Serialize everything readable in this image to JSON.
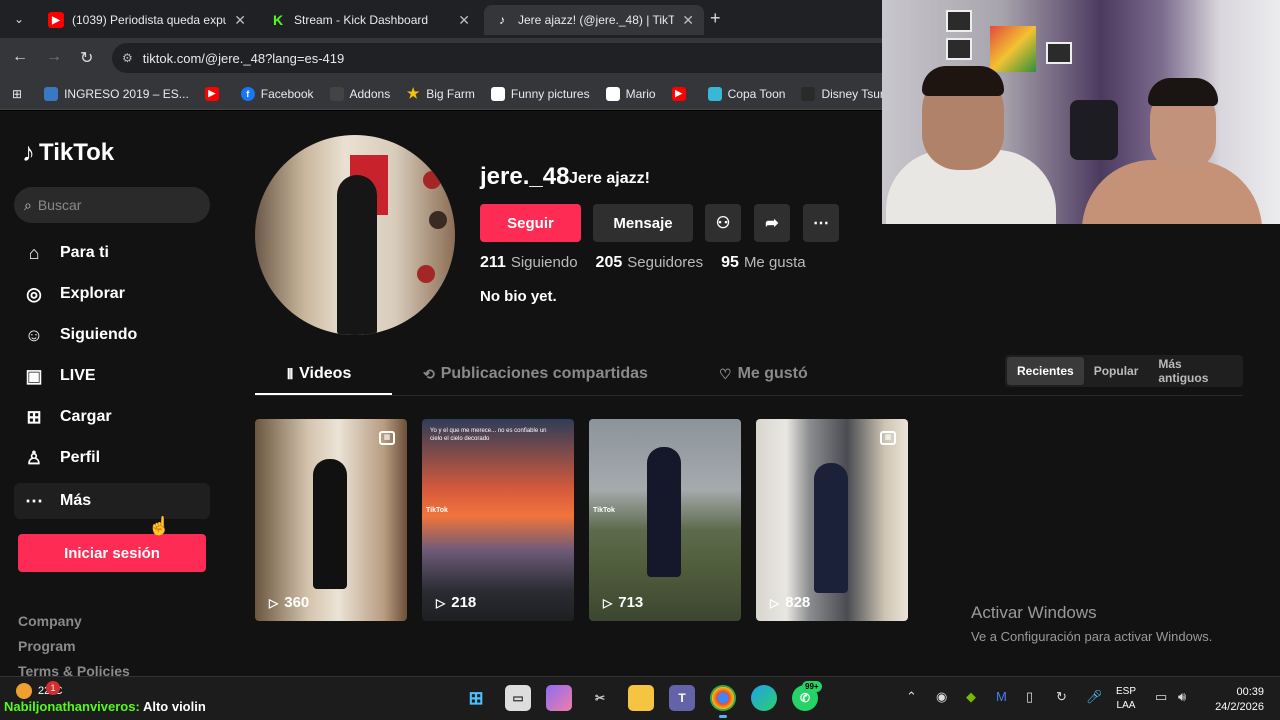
{
  "browser": {
    "tabs": [
      {
        "title": "(1039) Periodista queda expues",
        "icon": "youtube-icon",
        "color": "#ff0000"
      },
      {
        "title": "Stream - Kick Dashboard",
        "icon": "kick-icon",
        "color": "#53fc18"
      },
      {
        "title": "Jere ajazz! (@jere._48) | TikTok",
        "icon": "tiktok-icon",
        "color": "#000000"
      }
    ],
    "url": "tiktok.com/@jere._48?lang=es-419",
    "bookmarks": [
      {
        "label": "INGRESO 2019 – ES...",
        "icon": "globe-icon"
      },
      {
        "label": "",
        "icon": "youtube-icon"
      },
      {
        "label": "Facebook",
        "icon": "facebook-icon"
      },
      {
        "label": "Addons",
        "icon": "addons-icon"
      },
      {
        "label": "Big Farm",
        "icon": "star-icon"
      },
      {
        "label": "Funny pictures",
        "icon": "page-icon"
      },
      {
        "label": "Mario",
        "icon": "page-icon"
      },
      {
        "label": "",
        "icon": "youtube-icon"
      },
      {
        "label": "Copa Toon",
        "icon": "cloud-icon"
      },
      {
        "label": "Disney Tsum Tsum...",
        "icon": "disney-icon"
      }
    ]
  },
  "tiktok": {
    "logo": "TikTok",
    "search_placeholder": "Buscar",
    "nav": [
      {
        "label": "Para ti",
        "icon": "home-icon"
      },
      {
        "label": "Explorar",
        "icon": "compass-icon"
      },
      {
        "label": "Siguiendo",
        "icon": "following-icon"
      },
      {
        "label": "LIVE",
        "icon": "live-icon"
      },
      {
        "label": "Cargar",
        "icon": "upload-icon"
      },
      {
        "label": "Perfil",
        "icon": "profile-icon"
      },
      {
        "label": "Más",
        "icon": "more-icon"
      }
    ],
    "login_button": "Iniciar sesión",
    "footer_links": [
      "Company",
      "Program",
      "Terms & Policies"
    ],
    "profile": {
      "username": "jere._48",
      "nickname": "Jere ajazz!",
      "follow_button": "Seguir",
      "message_button": "Mensaje",
      "stats": [
        {
          "value": "211",
          "label": "Siguiendo"
        },
        {
          "value": "205",
          "label": "Seguidores"
        },
        {
          "value": "95",
          "label": "Me gusta"
        }
      ],
      "bio": "No bio yet."
    },
    "tabs": [
      {
        "label": "Videos",
        "icon": "grid-icon"
      },
      {
        "label": "Publicaciones compartidas",
        "icon": "repost-icon"
      },
      {
        "label": "Me gustó",
        "icon": "heart-off-icon"
      }
    ],
    "sort_options": [
      "Recientes",
      "Popular",
      "Más antiguos"
    ],
    "sort_selected": "Recientes",
    "videos": [
      {
        "views": "360",
        "pinned": true
      },
      {
        "views": "218",
        "pinned": false,
        "caption": "Yo y el que me merece... no es confiable un cielo el cielo decorado",
        "watermark": "TikTok"
      },
      {
        "views": "713",
        "pinned": false,
        "watermark": "TikTok"
      },
      {
        "views": "828",
        "pinned": true
      }
    ]
  },
  "windows_watermark": {
    "title": "Activar Windows",
    "subtitle": "Ve a Configuración para activar Windows."
  },
  "taskbar": {
    "weather": "22°C",
    "weather_badge": "1",
    "chat_user": "Nabiljonathanviveros:",
    "chat_message": "Alto violin",
    "whatsapp_badge": "99+",
    "language_line1": "ESP",
    "language_line2": "LAA",
    "time": "00:39",
    "date": "24/2/2026"
  },
  "colors": {
    "tiktok_red": "#fe2c55",
    "kick_green": "#53fc18",
    "windows_blue": "#5fb2f2"
  }
}
